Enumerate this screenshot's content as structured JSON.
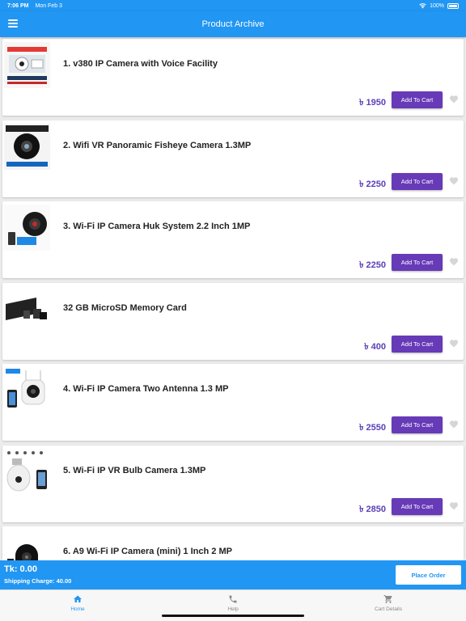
{
  "status_bar": {
    "time": "7:06 PM",
    "date": "Mon Feb 3",
    "battery": "100%"
  },
  "header": {
    "title": "Product Archive"
  },
  "products": [
    {
      "title": "1. v380 IP Camera with Voice Facility",
      "price": "৳ 1950",
      "button": "Add To Cart"
    },
    {
      "title": "2. Wifi VR Panoramic Fisheye Camera 1.3MP",
      "price": "৳ 2250",
      "button": "Add To Cart"
    },
    {
      "title": "3. Wi-Fi IP Camera Huk System 2.2 Inch 1MP",
      "price": "৳ 2250",
      "button": "Add To Cart"
    },
    {
      "title": "32 GB MicroSD Memory Card",
      "price": "৳ 400",
      "button": "Add To Cart"
    },
    {
      "title": "4. Wi-Fi IP Camera Two Antenna 1.3 MP",
      "price": "৳ 2550",
      "button": "Add To Cart"
    },
    {
      "title": "5. Wi-Fi IP VR Bulb Camera 1.3MP",
      "price": "৳ 2850",
      "button": "Add To Cart"
    },
    {
      "title": "6. A9 Wi-Fi IP Camera (mini) 1 Inch 2 MP",
      "price": "",
      "button": ""
    }
  ],
  "order": {
    "total": "Tk: 0.00",
    "shipping": "Shipping Charge: 40.00",
    "place_order": "Place Order"
  },
  "nav": [
    {
      "label": "Home",
      "icon": "home-icon"
    },
    {
      "label": "Help",
      "icon": "phone-icon"
    },
    {
      "label": "Cart Details",
      "icon": "cart-icon"
    }
  ],
  "colors": {
    "primary": "#2196f3",
    "button": "#673ab7",
    "price": "#5b3fb7"
  }
}
